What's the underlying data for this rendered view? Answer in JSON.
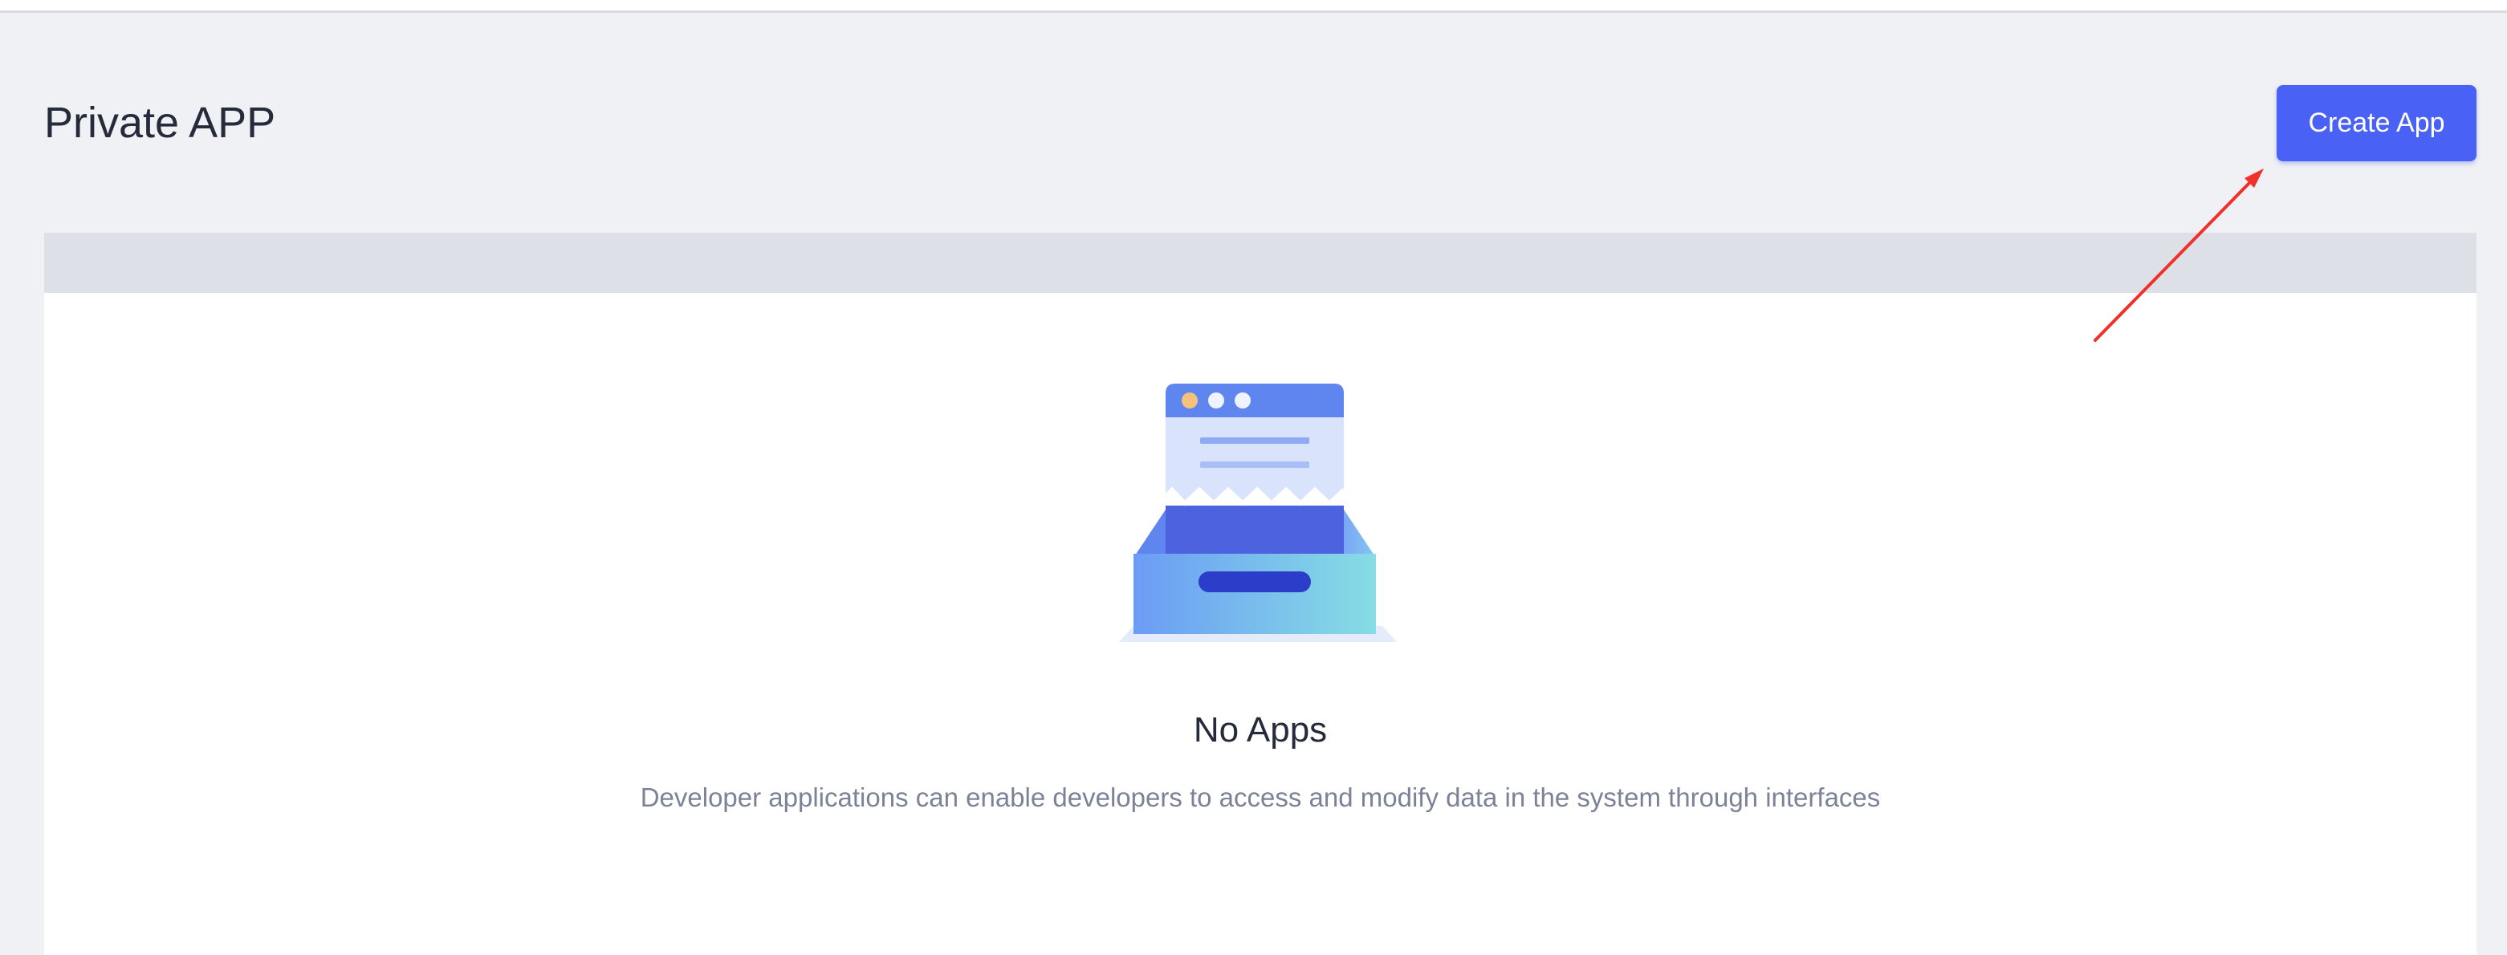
{
  "page": {
    "title": "Private APP"
  },
  "toolbar": {
    "create_label": "Create App"
  },
  "empty_state": {
    "title": "No Apps",
    "description": "Developer applications can enable developers to access and modify data in the system through interfaces",
    "illustration_icon": "empty-inbox-icon"
  },
  "annotation": {
    "arrow_color": "#f0302a"
  },
  "colors": {
    "accent": "#4a61f6",
    "background": "#f0f1f4",
    "card_header": "#dde0e6",
    "title_text": "#262b3b",
    "muted_text": "#7c8297"
  }
}
